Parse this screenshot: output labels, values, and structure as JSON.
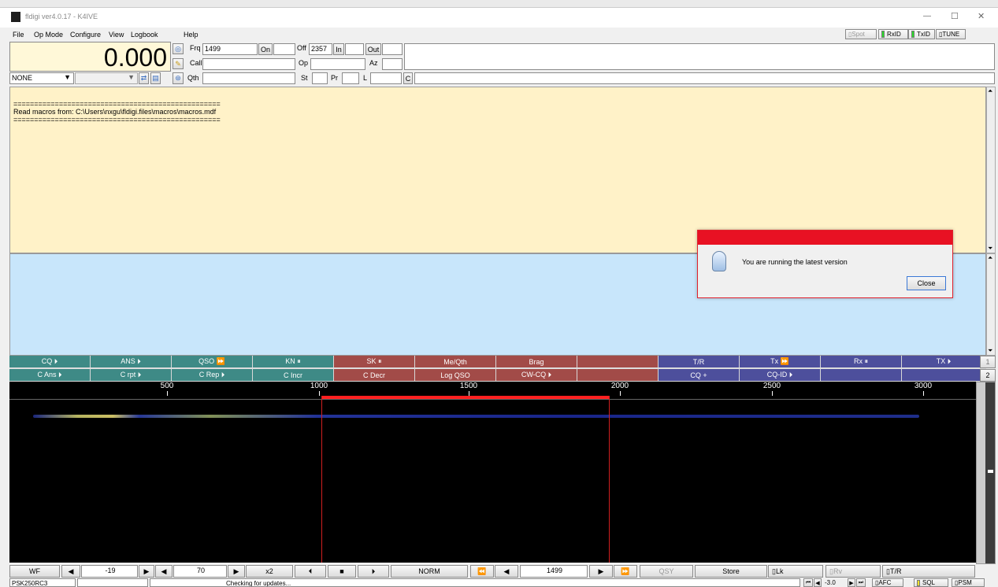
{
  "window": {
    "title": "fldigi ver4.0.17 - K4IVE",
    "controls": {
      "minimize": "—",
      "maximize": "☐",
      "close": "✕"
    }
  },
  "menu": {
    "items": [
      "File",
      "Op Mode",
      "Configure",
      "View",
      "Logbook",
      "Help"
    ]
  },
  "indicators": {
    "spot": "Spot",
    "rxid": "RxID",
    "txid": "TxID",
    "tune": "TUNE"
  },
  "freq_display": "0.000",
  "qso": {
    "frq_label": "Frq",
    "frq_value": "1499",
    "on_label": "On",
    "off_label": "Off",
    "off_value": "2357",
    "in_label": "In",
    "out_label": "Out",
    "call_label": "Call",
    "op_label": "Op",
    "az_label": "Az",
    "qth_label": "Qth",
    "st_label": "St",
    "pr_label": "Pr",
    "l_label": "L",
    "c_label": "C"
  },
  "mode_select": "NONE",
  "rx_text": [
    "==================================================",
    "Read macros from: C:\\Users\\nxgu\\fldigi.files\\macros\\macros.mdf",
    "=================================================="
  ],
  "dialog": {
    "message": "You are running the latest version",
    "close_label": "Close"
  },
  "macros": {
    "row1": [
      "CQ ⏵",
      "ANS ⏵",
      "QSO ⏩",
      "KN ⏸",
      "SK ⏸",
      "Me/Qth",
      "Brag",
      "",
      "T/R",
      "Tx ⏩",
      "Rx ⏸",
      "TX ⏵"
    ],
    "row2": [
      "C Ans ⏵",
      "C rpt ⏵",
      "C Rep ⏵",
      "C Incr",
      "C Decr",
      "Log QSO",
      "CW-CQ ⏵",
      "",
      "CQ +",
      "CQ-ID ⏵",
      "",
      ""
    ],
    "row1_num": "1",
    "row2_num": "2"
  },
  "scale": {
    "labels": [
      "500",
      "1000",
      "1500",
      "2000",
      "2500",
      "3000"
    ],
    "range_hz": [
      0,
      3000
    ]
  },
  "waterfall": {
    "passband_hz": [
      1000,
      2000
    ],
    "cursor_hz": 1499
  },
  "bottom_controls": {
    "wf": "WF",
    "ref_level": "-19",
    "range": "70",
    "zoom": "x2",
    "mode": "NORM",
    "carrier": "1499",
    "qsy": "QSY",
    "store": "Store",
    "lk": "Lk",
    "rv": "Rv",
    "tr": "T/R"
  },
  "status_bar": {
    "mode": "PSK250RC3",
    "message": "Checking for updates...",
    "s2n": "-3.0",
    "afc": "AFC",
    "sql": "SQL",
    "psm": "PSM"
  }
}
